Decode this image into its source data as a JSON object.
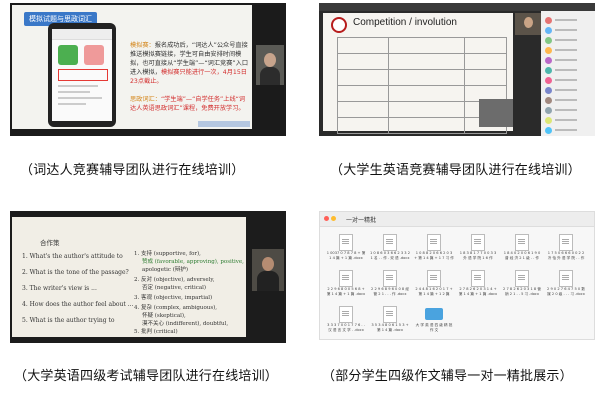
{
  "captions": [
    "（词达人竞赛辅导团队进行在线培训）",
    "（大学生英语竞赛辅导团队进行在线培训）",
    "（大学英语四级考试辅导团队进行在线培训）",
    "（部分学生四级作文辅导一对一精批展示）"
  ],
  "shot1": {
    "slide_title": "模拟试题与思政词汇",
    "para1_label": "模拟赛：",
    "para1_text": "报名成功后，“词达人”公众号直接推送模拟赛链接，学生可自由安排时间模拟，也可直接从“学生端”—“词汇竞赛”入口进入模拟，",
    "para1_highlight": "模拟赛只能进行一次，4月15日23点截止。",
    "para2_label": "思政词汇：",
    "para2_text": "“学生端”—“自学任务”上线“词达人英语思政词汇”课程，免费开放学习。"
  },
  "shot2": {
    "slide_title": "Competition / involution"
  },
  "shot3": {
    "left_title": "合作策",
    "left_lines": [
      "1. What's the author's attitude to",
      "2. What is the tone of the passage?",
      "3. The writer's view is ...",
      "4. How does the author feel about ...",
      "5. What is the author trying to"
    ],
    "right_lines": [
      "1. 支持 (supportive, for),",
      "赞成 (favorable, approving), positive,",
      "apologetic (辩护)",
      "2. 反对 (objective), adversely,",
      "否定 (negative, critical)",
      "3. 客观 (objective, impartial)",
      "4. 复杂 (complex, ambiguous),",
      "怀疑 (skeptical),",
      "漠不关心 (indifferent), doubtful,",
      "5. 批判 (critical)"
    ]
  },
  "shot4": {
    "folder_title": "一对一精批",
    "files": [
      "1 0037 0 7 8 7 8 + 第 1 4 篇 + 1 篇 .docx",
      "1 0 8 6 0 3 6 6 2 3 3 2 1 名 . . 作 . 双 语 .docx",
      "1 0 8 8 2 0 6 6 2 0 3 + 第 1 4 篇 + 1 7 习 作 .docx",
      "1 8 3 8 1 7 7 0 0 3 3 外 语 学 院 1 6 作 .docx",
      "1 8 4 0 2 0 0 6 1 9 0 普 经 济 2 1 级 . . 作 .docx",
      "1 7 5 0 6 6 6 0 0 2 2 冷 怡 外 语 学 院 . . 作 .docx",
      "2 2 9 6 8 0 0 5 6 8 + 第 1 4 篇 + 1 篇 .docx",
      "2 2 9 6 8 9 6 0 0 8 经 管 2 1 . . . 作 .docx",
      "2 4 4 8 1 6 2 0 1 7 + 第 1 4 篇 + 1 2 篇 .docx",
      "2 7 8 2 6 2 0 3 1 4 + 第 1 4 篇 + 1 篇 .docx",
      "2 7 8 2 6 2 0 3 1 8 营 销 2 1 . . 5 习 .docx",
      "2 9 0 2 7 6 4 7 5 0 数 媒 2 0 级 . . . 习 .docx",
      "3 3 3 7 0 0 1 7 7 6 . . 汉 语 言 文 学 . .docx",
      "3 5 3 4 8 0 6 1 5 3 + 第 1 4 篇 .docx",
      "大 学 英 语 四 级 精 批 作 文"
    ]
  }
}
